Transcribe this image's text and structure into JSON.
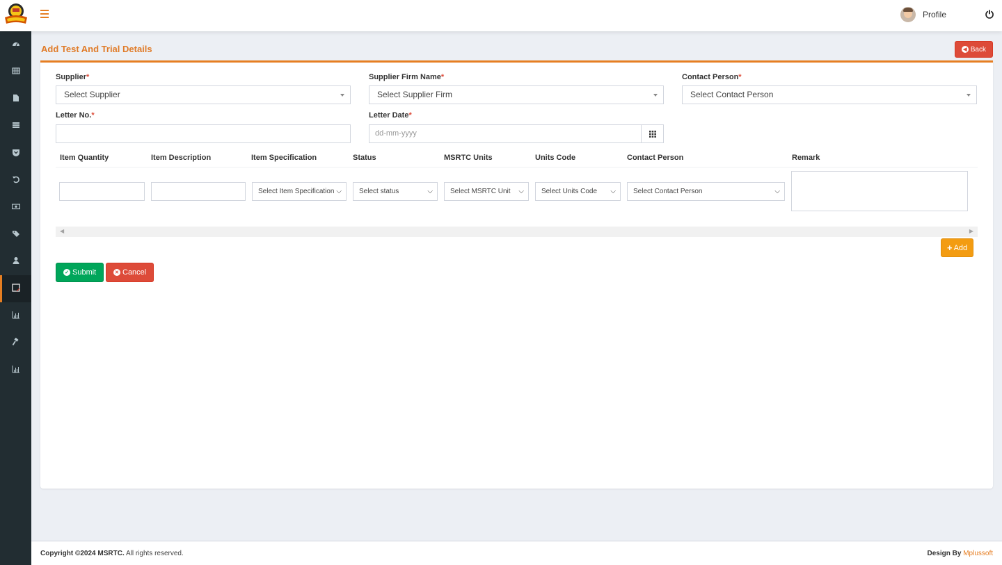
{
  "header": {
    "logo_alt": "MSRTC logo",
    "profile_label": "Profile"
  },
  "sidebar": {
    "items": [
      {
        "icon": "dashboard-icon",
        "active": false
      },
      {
        "icon": "table-icon",
        "active": false
      },
      {
        "icon": "file-icon",
        "active": false
      },
      {
        "icon": "list-icon",
        "active": false
      },
      {
        "icon": "chevron-square-icon",
        "active": false
      },
      {
        "icon": "undo-icon",
        "active": false
      },
      {
        "icon": "money-icon",
        "active": false
      },
      {
        "icon": "tags-icon",
        "active": false
      },
      {
        "icon": "user-icon",
        "active": false
      },
      {
        "icon": "note-icon",
        "active": true
      },
      {
        "icon": "bar-chart-icon",
        "active": false
      },
      {
        "icon": "gavel-icon",
        "active": false
      },
      {
        "icon": "bar-chart-icon",
        "active": false
      }
    ]
  },
  "page": {
    "title": "Add Test And Trial Details",
    "back_label": "Back"
  },
  "form": {
    "supplier": {
      "label": "Supplier",
      "placeholder": "Select Supplier"
    },
    "supplier_firm": {
      "label": "Supplier Firm Name",
      "placeholder": "Select Supplier Firm"
    },
    "contact_person": {
      "label": "Contact Person",
      "placeholder": "Select Contact Person"
    },
    "letter_no": {
      "label": "Letter No.",
      "value": ""
    },
    "letter_date": {
      "label": "Letter Date",
      "placeholder": "dd-mm-yyyy"
    },
    "required_mark": "*"
  },
  "items_table": {
    "columns": [
      "Item Quantity",
      "Item Description",
      "Item Specification",
      "Status",
      "MSRTC Units",
      "Units Code",
      "Contact Person",
      "Remark"
    ],
    "row": {
      "item_quantity": "",
      "item_description": "",
      "item_specification": "Select Item Specification",
      "status": "Select status",
      "msrtc_unit": "Select MSRTC Unit",
      "units_code": "Select Units Code",
      "contact_person": "Select Contact Person",
      "remark": ""
    },
    "add_label": "Add"
  },
  "actions": {
    "submit_label": "Submit",
    "cancel_label": "Cancel"
  },
  "footer": {
    "copyright_bold": "Copyright ©2024 MSRTC.",
    "copyright_rest": " All rights reserved.",
    "design_by": "Design By ",
    "designer": "Mplussoft"
  },
  "colors": {
    "accent": "#e67e22",
    "sidebar_bg": "#222d32",
    "danger": "#dd4b39",
    "success": "#00a65a",
    "warning": "#f39c12"
  }
}
